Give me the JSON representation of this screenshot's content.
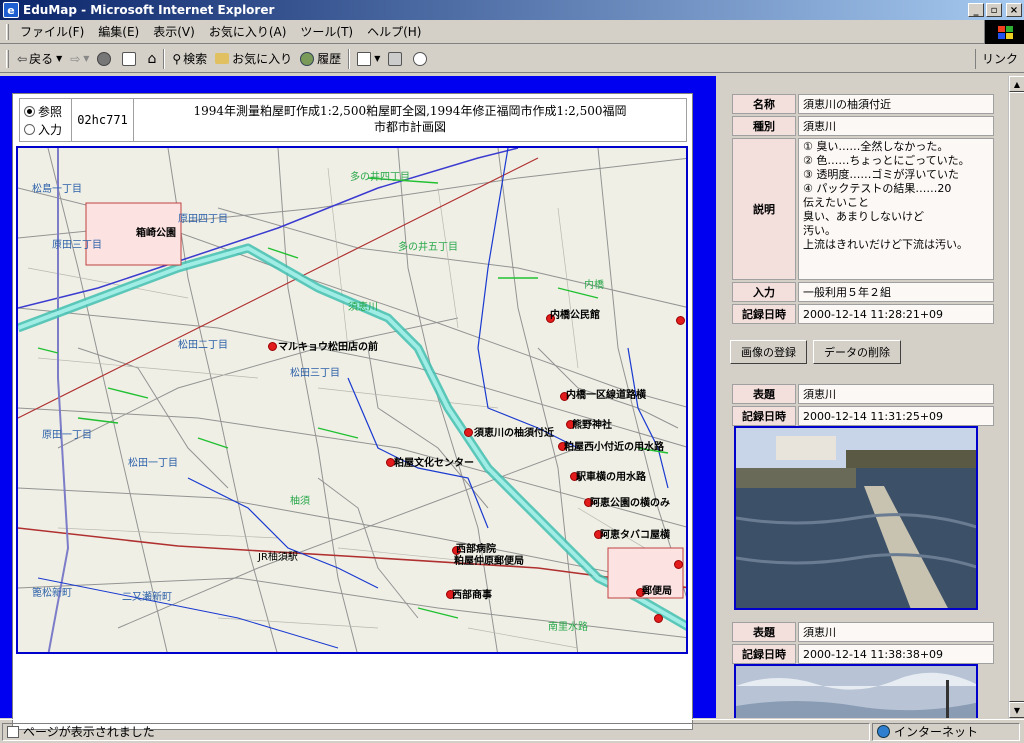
{
  "window": {
    "title": "EduMap - Microsoft Internet Explorer",
    "minimize": "_",
    "maximize": "▫",
    "close": "×"
  },
  "menu": [
    "ファイル(F)",
    "編集(E)",
    "表示(V)",
    "お気に入り(A)",
    "ツール(T)",
    "ヘルプ(H)"
  ],
  "toolbar": {
    "back": "戻る",
    "search": "検索",
    "favorites": "お気に入り",
    "history": "履歴",
    "links": "リンク"
  },
  "map": {
    "radio_view": "参照",
    "radio_input": "入力",
    "code": "02hc771",
    "title_line1": "1994年測量粕屋町作成1:2,500粕屋町全図,1994年修正福岡市作成1:2,500福岡",
    "title_line2": "市都市計画図",
    "labels": {
      "matsushima1": "松島一丁目",
      "harada4": "原田四丁目",
      "harada3": "原田三丁目",
      "harada1": "原田一丁目",
      "matsuda2": "松田二丁目",
      "matsuda3": "松田三丁目",
      "matsuda1": "松田一丁目",
      "tanoizu4": "多の井四丁目",
      "tanoizu5": "多の井五丁目",
      "sueriver": "須恵川",
      "uchihashi": "内橋",
      "yuzu": "柚須",
      "kushiro": "篦松新町",
      "futamata": "二又瀬新町",
      "minamimizu": "南里水路",
      "park": "箱崎公園",
      "station": "JR柚須駅"
    },
    "points": {
      "marukyo": "マルキョウ松田店の前",
      "yuzusite": "須恵川の柚須付近",
      "bunka": "粕屋文化センター",
      "uchihashikoen": "内橋公民館",
      "uchihashi1": "内橋一区線道路横",
      "kumano": "熊野神社",
      "kasuyanishi": "粕屋西小付近の用水路",
      "ekirosha": "駅車横の用水路",
      "akashi": "阿恵公園の横のみ",
      "akashitabako": "阿恵タバコ屋横",
      "saibu": "西部病院",
      "yubin": "粕屋仲原郵便局",
      "nishida": "西部商事",
      "yahata": "郵便局"
    }
  },
  "record": {
    "name_label": "名称",
    "name_value": "須恵川の柚須付近",
    "type_label": "種別",
    "type_value": "須恵川",
    "desc_label": "説明",
    "desc_lines": [
      "① 臭い……全然しなかった。",
      "② 色……ちょっとにごっていた。",
      "③ 透明度……ゴミが浮いていた",
      "④ パックテストの結果……20",
      "伝えたいこと",
      "臭い、あまりしないけど",
      "汚い。",
      "上流はきれいだけど下流は汚い。"
    ],
    "input_label": "入力",
    "input_value": "一般利用５年２組",
    "date_label": "記録日時",
    "date_value": "2000-12-14 11:28:21+09"
  },
  "buttons": {
    "register_image": "画像の登録",
    "delete_data": "データの削除"
  },
  "photos": [
    {
      "label_title": "表題",
      "title": "須恵川",
      "label_date": "記録日時",
      "date": "2000-12-14 11:31:25+09"
    },
    {
      "label_title": "表題",
      "title": "須恵川",
      "label_date": "記録日時",
      "date": "2000-12-14 11:38:38+09"
    }
  ],
  "status": {
    "message": "ページが表示されました",
    "zone": "インターネット"
  }
}
